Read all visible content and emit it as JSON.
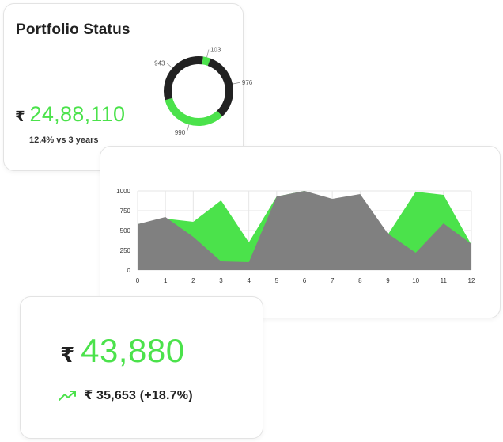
{
  "portfolio": {
    "title": "Portfolio Status",
    "currency": "₹",
    "value": "24,88,110",
    "growth": "12.4% vs 3 years",
    "donut": {
      "segments": [
        {
          "label": "976",
          "value": 976,
          "color": "#222222"
        },
        {
          "label": "990",
          "value": 990,
          "color": "#4be24b"
        },
        {
          "label": "943",
          "value": 943,
          "color": "#222222"
        },
        {
          "label": "103",
          "value": 103,
          "color": "#4be24b"
        }
      ]
    }
  },
  "chart_data": {
    "type": "area",
    "x": [
      0,
      1,
      2,
      3,
      4,
      5,
      6,
      7,
      8,
      9,
      10,
      11,
      12
    ],
    "xlim": [
      0,
      12
    ],
    "ylim": [
      0,
      1000
    ],
    "y_ticks": [
      0,
      250,
      500,
      750,
      1000
    ],
    "grid": true,
    "series": [
      {
        "color": "#4be24b",
        "values": [
          580,
          650,
          610,
          880,
          350,
          930,
          1000,
          880,
          950,
          450,
          990,
          950,
          320
        ]
      },
      {
        "color": "#808080",
        "values": [
          580,
          670,
          420,
          110,
          100,
          930,
          1000,
          900,
          960,
          460,
          220,
          590,
          330
        ]
      }
    ]
  },
  "gain": {
    "currency": "₹",
    "value": "43,880",
    "delta": "₹ 35,653 (+18.7%)",
    "icon": "trending-up-icon",
    "accent": "#4be24b"
  },
  "colors": {
    "accent": "#4be24b",
    "dark": "#222222",
    "gray": "#808080"
  }
}
